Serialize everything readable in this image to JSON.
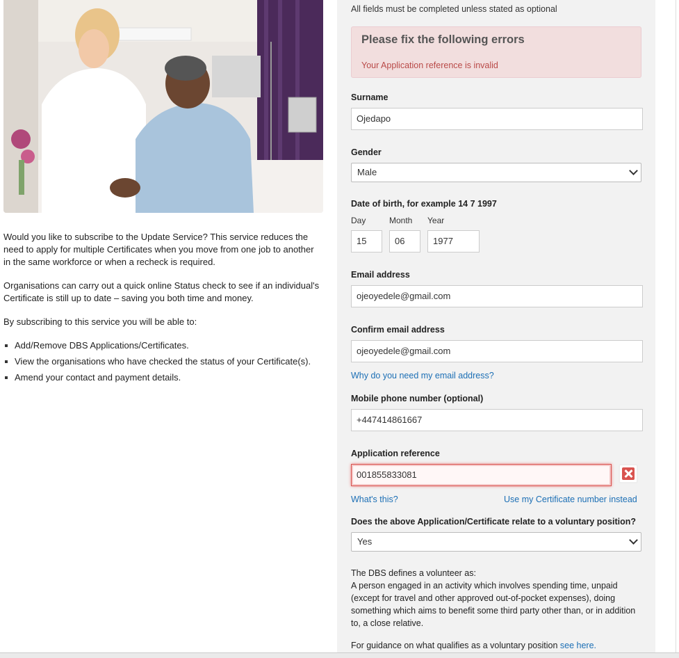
{
  "left": {
    "photo_alt": "",
    "paragraphs": [
      "Would you like to subscribe to the Update Service? This service reduces the need to apply for multiple Certificates when you move from one job to another in the same workforce or when a recheck is required.",
      "Organisations can carry out a quick online Status check to see if an individual's Certificate is still up to date – saving you both time and money.",
      "By subscribing to this service you will be able to:"
    ],
    "bullets": [
      "Add/Remove DBS Applications/Certificates.",
      "View the organisations who have checked the status of your Certificate(s).",
      "Amend your contact and payment details."
    ]
  },
  "form": {
    "note": "All fields must be completed unless stated as optional",
    "errors": {
      "title": "Please fix the following errors",
      "message": "Your Application reference is invalid"
    },
    "surname": {
      "label": "Surname",
      "value": "Ojedapo"
    },
    "gender": {
      "label": "Gender",
      "value": "Male"
    },
    "dob": {
      "label": "Date of birth, for example 14 7 1997",
      "day_label": "Day",
      "month_label": "Month",
      "year_label": "Year",
      "day": "15",
      "month": "06",
      "year": "1977"
    },
    "email": {
      "label": "Email address",
      "value": "ojeoyedele@gmail.com"
    },
    "confirm_email": {
      "label": "Confirm email address",
      "value": "ojeoyedele@gmail.com"
    },
    "email_why_link": "Why do you need my email address?",
    "mobile": {
      "label": "Mobile phone number (optional)",
      "value": "+447414861667"
    },
    "app_ref": {
      "label": "Application reference",
      "value": "001855833081"
    },
    "whats_this_link": "What's this?",
    "use_cert_link": "Use my Certificate number instead",
    "voluntary": {
      "label": "Does the above Application/Certificate relate to a voluntary position?",
      "value": "Yes"
    },
    "volunteer_def_title": "The DBS defines a volunteer as:",
    "volunteer_def_text": "A person engaged in an activity which involves spending time, unpaid (except for travel and other approved out-of-pocket expenses), doing something which aims to benefit some third party other than, or in addition to, a close relative.",
    "guidance_text": "For guidance on what qualifies as a voluntary position",
    "guidance_link": "see here."
  },
  "colors": {
    "panel_bg": "#f2f2f2",
    "error_bg": "#f2dede",
    "error_text": "#b94a48",
    "link": "#1c6fb5",
    "error_icon": "#d9534f"
  }
}
